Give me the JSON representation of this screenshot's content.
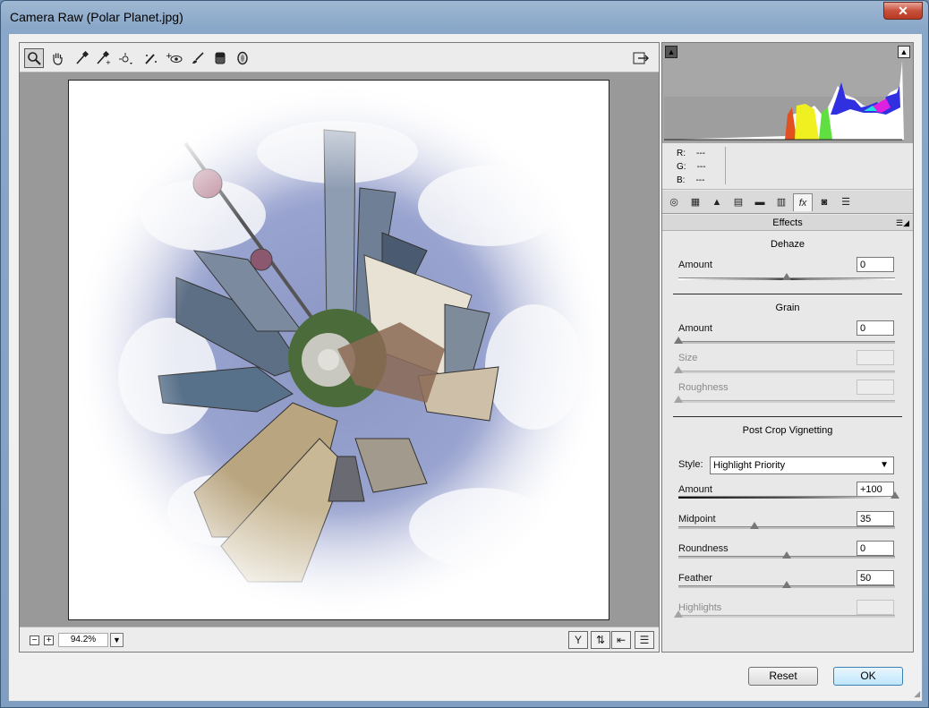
{
  "window": {
    "title": "Camera Raw (Polar Planet.jpg)"
  },
  "toolbar": {
    "tools": [
      {
        "name": "zoom-tool-icon",
        "glyph": "🔍"
      },
      {
        "name": "hand-tool-icon",
        "glyph": "✋"
      },
      {
        "name": "white-balance-tool-icon",
        "glyph": "✒"
      },
      {
        "name": "color-sampler-tool-icon",
        "glyph": "✒"
      },
      {
        "name": "targeted-adjustment-tool-icon",
        "glyph": "⊹"
      },
      {
        "name": "spot-removal-tool-icon",
        "glyph": "✎"
      },
      {
        "name": "red-eye-removal-tool-icon",
        "glyph": "👁"
      },
      {
        "name": "adjustment-brush-icon",
        "glyph": "🖌"
      },
      {
        "name": "graduated-filter-icon",
        "glyph": "▮"
      },
      {
        "name": "radial-filter-icon",
        "glyph": "⬯"
      }
    ],
    "open_preferences_glyph": "⇥"
  },
  "status": {
    "zoom": "94.2%",
    "minus": "−",
    "plus": "+"
  },
  "histogram": {
    "r_label": "R:",
    "g_label": "G:",
    "b_label": "B:",
    "r_value": "---",
    "g_value": "---",
    "b_value": "---"
  },
  "panel_tabs": [
    "◎",
    "▦",
    "▲",
    "▤",
    "▬",
    "▥",
    "fx",
    "◙",
    "☰"
  ],
  "effects": {
    "header": "Effects",
    "dehaze": {
      "title": "Dehaze",
      "amount_label": "Amount",
      "amount": "0",
      "amount_pos": 0.5
    },
    "grain": {
      "title": "Grain",
      "amount_label": "Amount",
      "amount": "0",
      "amount_pos": 0.0,
      "size_label": "Size",
      "roughness_label": "Roughness"
    },
    "vignette": {
      "title": "Post Crop Vignetting",
      "style_label": "Style:",
      "style_value": "Highlight Priority",
      "amount_label": "Amount",
      "amount": "+100",
      "amount_pos": 1.0,
      "midpoint_label": "Midpoint",
      "midpoint": "35",
      "midpoint_pos": 0.35,
      "roundness_label": "Roundness",
      "roundness": "0",
      "roundness_pos": 0.5,
      "feather_label": "Feather",
      "feather": "50",
      "feather_pos": 0.5,
      "highlights_label": "Highlights",
      "highlights_pos": 0.0
    }
  },
  "buttons": {
    "reset": "Reset",
    "ok": "OK"
  }
}
